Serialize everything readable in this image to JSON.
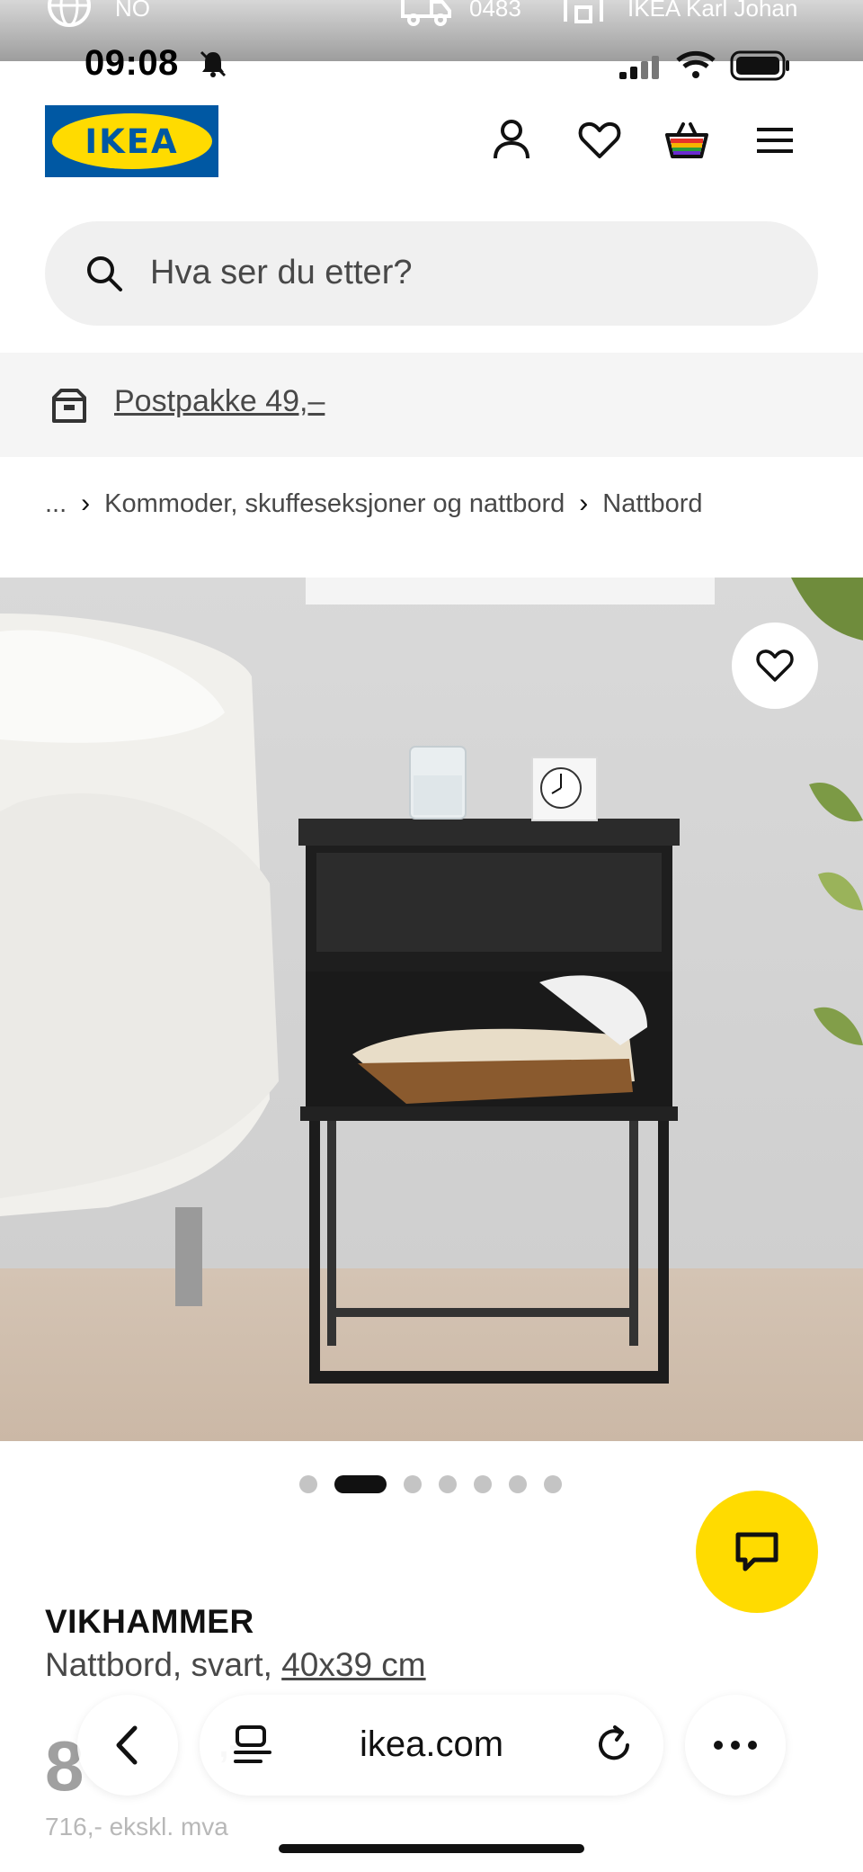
{
  "status_bar": {
    "region": "NO",
    "postcode": "0483",
    "store": "IKEA Karl Johan",
    "time": "09:08"
  },
  "header": {
    "logo_text": "IKEA",
    "icons": [
      "account-icon",
      "heart-icon",
      "basket-icon",
      "menu-icon"
    ]
  },
  "search": {
    "placeholder": "Hva ser du etter?"
  },
  "delivery": {
    "label": "Postpakke 49,–"
  },
  "breadcrumb": {
    "ellipsis": "...",
    "items": [
      "Kommoder, skuffeseksjoner og nattbord",
      "Nattbord"
    ]
  },
  "carousel": {
    "total": 7,
    "active_index": 1
  },
  "product": {
    "name": "VIKHAMMER",
    "description": "Nattbord, svart,",
    "size_link": "40x39 cm",
    "price_visible": "8",
    "price_suffix": ",-",
    "price_ex_vat": "716,- ekskl. mva"
  },
  "browser": {
    "url": "ikea.com"
  },
  "colors": {
    "ikea_blue": "#0058a3",
    "ikea_yellow": "#ffdb00",
    "text_dark": "#111111",
    "text_muted": "#484848"
  }
}
